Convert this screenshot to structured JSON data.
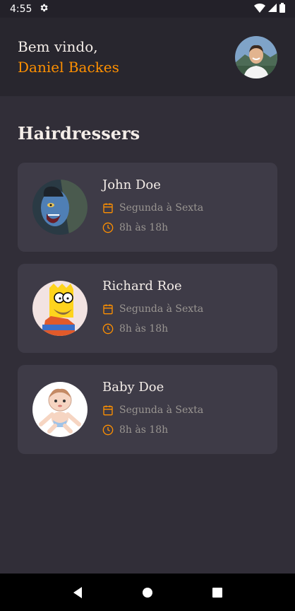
{
  "status_bar": {
    "time": "4:55"
  },
  "header": {
    "greeting": "Bem vindo,",
    "user_name": "Daniel Backes"
  },
  "page_title": "Hairdressers",
  "providers": [
    {
      "name": "John Doe",
      "days": "Segunda à Sexta",
      "hours": "8h às 18h"
    },
    {
      "name": "Richard Roe",
      "days": "Segunda à Sexta",
      "hours": "8h às 18h"
    },
    {
      "name": "Baby Doe",
      "days": "Segunda à Sexta",
      "hours": "8h às 18h"
    }
  ],
  "colors": {
    "background": "#312e38",
    "header": "#28262e",
    "card": "#3e3b47",
    "accent": "#ff9000",
    "text": "#f4ede8",
    "muted": "#999591"
  }
}
